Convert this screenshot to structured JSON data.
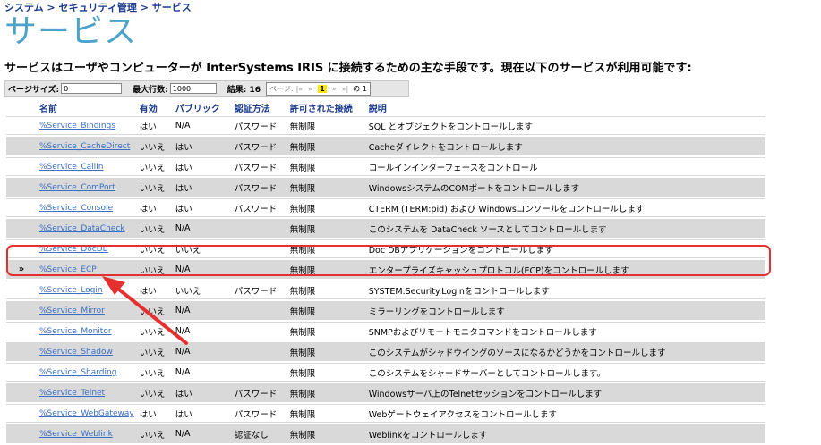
{
  "breadcrumb": "システム > セキュリティ管理 > サービス",
  "title": "サービス",
  "intro": "サービスはユーザやコンピューターが InterSystems IRIS に接続するための主な手段です。現在以下のサービスが利用可能です:",
  "pager": {
    "page_size_label": "ページサイズ:",
    "page_size_value": "0",
    "max_rows_label": "最大行数:",
    "max_rows_value": "1000",
    "results_label": "結果: 16",
    "page_label": "ページ:",
    "first": "|«",
    "prev": "«",
    "current": "1",
    "next": "»",
    "last": "»|",
    "of": "の 1"
  },
  "columns": [
    "名前",
    "有効",
    "パブリック",
    "認証方法",
    "許可された接続",
    "説明"
  ],
  "rows": [
    {
      "name": "%Service_Bindings",
      "enabled": "はい",
      "public": "N/A",
      "auth": "パスワード",
      "allowed": "無制限",
      "desc": "SQL とオブジェクトをコントロールします",
      "marker": ""
    },
    {
      "name": "%Service_CacheDirect",
      "enabled": "いいえ",
      "public": "はい",
      "auth": "パスワード",
      "allowed": "無制限",
      "desc": "Cacheダイレクトをコントロールします",
      "marker": ""
    },
    {
      "name": "%Service_CallIn",
      "enabled": "いいえ",
      "public": "はい",
      "auth": "パスワード",
      "allowed": "無制限",
      "desc": "コールインインターフェースをコントロール",
      "marker": ""
    },
    {
      "name": "%Service_ComPort",
      "enabled": "いいえ",
      "public": "はい",
      "auth": "パスワード",
      "allowed": "無制限",
      "desc": "WindowsシステムのCOMポートをコントロールします",
      "marker": ""
    },
    {
      "name": "%Service_Console",
      "enabled": "はい",
      "public": "はい",
      "auth": "パスワード",
      "allowed": "無制限",
      "desc": "CTERM (TERM:pid) および Windowsコンソールをコントロールします",
      "marker": ""
    },
    {
      "name": "%Service_DataCheck",
      "enabled": "いいえ",
      "public": "N/A",
      "auth": "",
      "allowed": "無制限",
      "desc": "このシステムを DataCheck ソースとしてコントロールします",
      "marker": ""
    },
    {
      "name": "%Service_DocDB",
      "enabled": "いいえ",
      "public": "いいえ",
      "auth": "",
      "allowed": "無制限",
      "desc": "Doc DBアプリケーションをコントロールします",
      "marker": ""
    },
    {
      "name": "%Service_ECP",
      "enabled": "いいえ",
      "public": "N/A",
      "auth": "",
      "allowed": "無制限",
      "desc": "エンタープライズキャッシュプロトコル(ECP)をコントロールします",
      "marker": "»"
    },
    {
      "name": "%Service_Login",
      "enabled": "はい",
      "public": "いいえ",
      "auth": "パスワード",
      "allowed": "無制限",
      "desc": "SYSTEM.Security.Loginをコントロールします",
      "marker": ""
    },
    {
      "name": "%Service_Mirror",
      "enabled": "いいえ",
      "public": "N/A",
      "auth": "",
      "allowed": "無制限",
      "desc": "ミラーリングをコントロールします",
      "marker": ""
    },
    {
      "name": "%Service_Monitor",
      "enabled": "いいえ",
      "public": "N/A",
      "auth": "",
      "allowed": "無制限",
      "desc": "SNMPおよびリモートモニタコマンドをコントロールします",
      "marker": ""
    },
    {
      "name": "%Service_Shadow",
      "enabled": "いいえ",
      "public": "N/A",
      "auth": "",
      "allowed": "無制限",
      "desc": "このシステムがシャドウイングのソースになるかどうかをコントロールします",
      "marker": ""
    },
    {
      "name": "%Service_Sharding",
      "enabled": "いいえ",
      "public": "N/A",
      "auth": "",
      "allowed": "無制限",
      "desc": "このシステムをシャードサーバーとしてコントロールします。",
      "marker": ""
    },
    {
      "name": "%Service_Telnet",
      "enabled": "いいえ",
      "public": "はい",
      "auth": "パスワード",
      "allowed": "無制限",
      "desc": "Windowsサーバ上のTelnetセッションをコントロールします",
      "marker": ""
    },
    {
      "name": "%Service_WebGateway",
      "enabled": "はい",
      "public": "はい",
      "auth": "パスワード",
      "allowed": "無制限",
      "desc": "Webゲートウェイアクセスをコントロールします",
      "marker": ""
    },
    {
      "name": "%Service_Weblink",
      "enabled": "いいえ",
      "public": "N/A",
      "auth": "認証なし",
      "allowed": "無制限",
      "desc": "Weblinkをコントロールします",
      "marker": ""
    }
  ],
  "colors": {
    "title": "#4aa3c8",
    "link": "#3a6fc4",
    "header": "#1a3a8f",
    "row_alt": "#d9d9d9",
    "highlight": "#e53030",
    "pager_current": "#ffe400"
  }
}
